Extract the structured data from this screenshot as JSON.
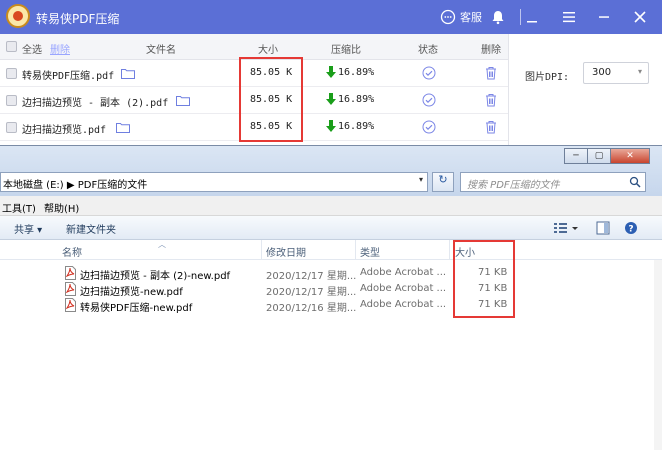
{
  "compressor": {
    "title": "转易侠PDF压缩",
    "kefu_label": "客服",
    "header": {
      "select_all": "全选",
      "delete_link": "删除",
      "filename": "文件名",
      "size": "大小",
      "ratio": "压缩比",
      "status": "状态",
      "delete": "删除"
    },
    "rows": [
      {
        "name": "转易侠PDF压缩.pdf",
        "size": "85.05 K",
        "ratio": "16.89%"
      },
      {
        "name": "边扫描边预览 - 副本 (2).pdf",
        "size": "85.05 K",
        "ratio": "16.89%"
      },
      {
        "name": "边扫描边预览.pdf",
        "size": "85.05 K",
        "ratio": "16.89%"
      }
    ],
    "dpi_label": "图片DPI:",
    "dpi_value": "300",
    "colors": {
      "titlebar": "#5b6fd6",
      "down_arrow": "#1a9e1a",
      "status_check": "#7b86e6",
      "highlight": "#e53935"
    }
  },
  "explorer": {
    "breadcrumb": "本地磁盘 (E:)  ▶  PDF压缩的文件",
    "search_placeholder": "搜索 PDF压缩的文件",
    "menu": {
      "tools": "工具(T)",
      "help": "帮助(H)"
    },
    "toolbar": {
      "share": "共享 ▾",
      "new_folder": "新建文件夹"
    },
    "columns": {
      "name": "名称",
      "modified": "修改日期",
      "type": "类型",
      "size": "大小"
    },
    "files": [
      {
        "name": "边扫描边预览 - 副本 (2)-new.pdf",
        "date": "2020/12/17 星期...",
        "type": "Adobe Acrobat ...",
        "size": "71 KB"
      },
      {
        "name": "边扫描边预览-new.pdf",
        "date": "2020/12/17 星期...",
        "type": "Adobe Acrobat ...",
        "size": "71 KB"
      },
      {
        "name": "转易侠PDF压缩-new.pdf",
        "date": "2020/12/16 星期...",
        "type": "Adobe Acrobat ...",
        "size": "71 KB"
      }
    ]
  }
}
